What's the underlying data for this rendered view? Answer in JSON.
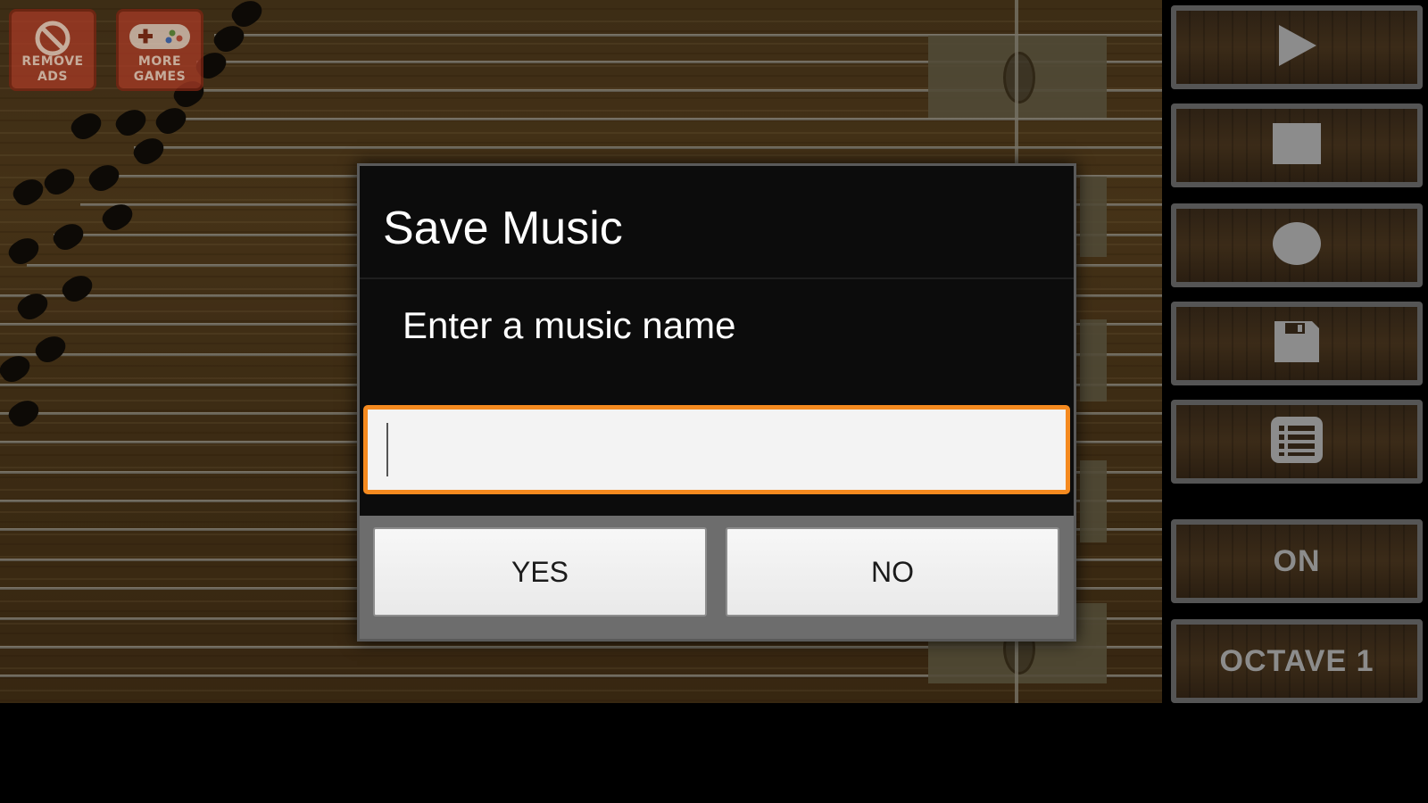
{
  "ads": {
    "remove_ads": {
      "label": "REMOVE ADS",
      "icon": "no-ads-icon"
    },
    "more_games": {
      "label": "MORE GAMES",
      "icon": "gamepad-icon"
    }
  },
  "controls": {
    "play": {
      "icon": "play-icon"
    },
    "stop": {
      "icon": "stop-icon"
    },
    "record": {
      "icon": "record-icon"
    },
    "save": {
      "icon": "floppy-disk-icon"
    },
    "list": {
      "icon": "list-icon"
    },
    "toggle_label": "ON",
    "octave_label": "OCTAVE 1"
  },
  "dialog": {
    "title": "Save Music",
    "message": "Enter a music name",
    "input_value": "",
    "yes_label": "YES",
    "no_label": "NO"
  },
  "colors": {
    "input_focus_border": "#f58a1f",
    "ad_button": "#a83a25",
    "control_border": "#555555"
  }
}
